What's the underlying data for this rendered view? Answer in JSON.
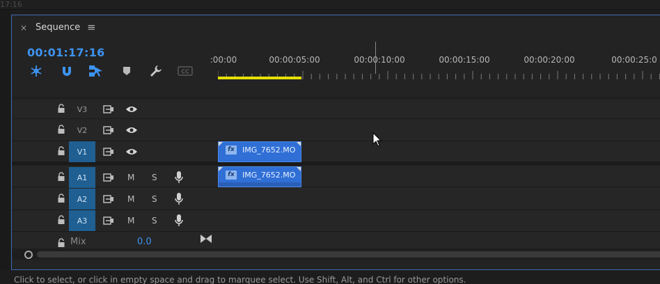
{
  "top_strip": {
    "timecode_fragment": "17:16"
  },
  "sequence_panel": {
    "tab": {
      "close_glyph": "×",
      "title": "Sequence",
      "menu_glyph": "≡"
    },
    "timecode": "00:01:17:16",
    "tools": [
      {
        "name": "insert-nest-icon",
        "active": true
      },
      {
        "name": "snap-icon",
        "active": true
      },
      {
        "name": "linked-selection-icon",
        "active": true
      },
      {
        "name": "add-marker-icon",
        "active": false
      },
      {
        "name": "wrench-icon",
        "active": false
      },
      {
        "name": "captions-icon",
        "active": false
      }
    ],
    "ruler": {
      "labels": [
        ":00:00",
        "00:00:05:00",
        "00:00:10:00",
        "00:00:15:00",
        "00:00:20:00",
        "00:00:25:0"
      ],
      "work_area_color": "#e5e000",
      "playhead_time": "00:00:10:00"
    },
    "video_tracks": [
      {
        "id": "V3",
        "targeted": false
      },
      {
        "id": "V2",
        "targeted": false
      },
      {
        "id": "V1",
        "targeted": true
      }
    ],
    "audio_tracks": [
      {
        "id": "A1",
        "targeted": true,
        "mute": "M",
        "solo": "S"
      },
      {
        "id": "A2",
        "targeted": true,
        "mute": "M",
        "solo": "S"
      },
      {
        "id": "A3",
        "targeted": true,
        "mute": "M",
        "solo": "S"
      }
    ],
    "mix": {
      "label": "Mix",
      "value": "0.0"
    },
    "clips": [
      {
        "track": "V1",
        "fx": "fx",
        "name": "IMG_7652.MO"
      },
      {
        "track": "A1",
        "fx": "fx",
        "name": "IMG_7652.MO"
      }
    ],
    "accent_color": "#3d93f0",
    "target_color": "#1f5f92",
    "clip_color": "#2f6fd6"
  },
  "status_bar": {
    "text": "Click to select, or click in empty space and drag to marquee select. Use Shift, Alt, and Ctrl for other options."
  }
}
